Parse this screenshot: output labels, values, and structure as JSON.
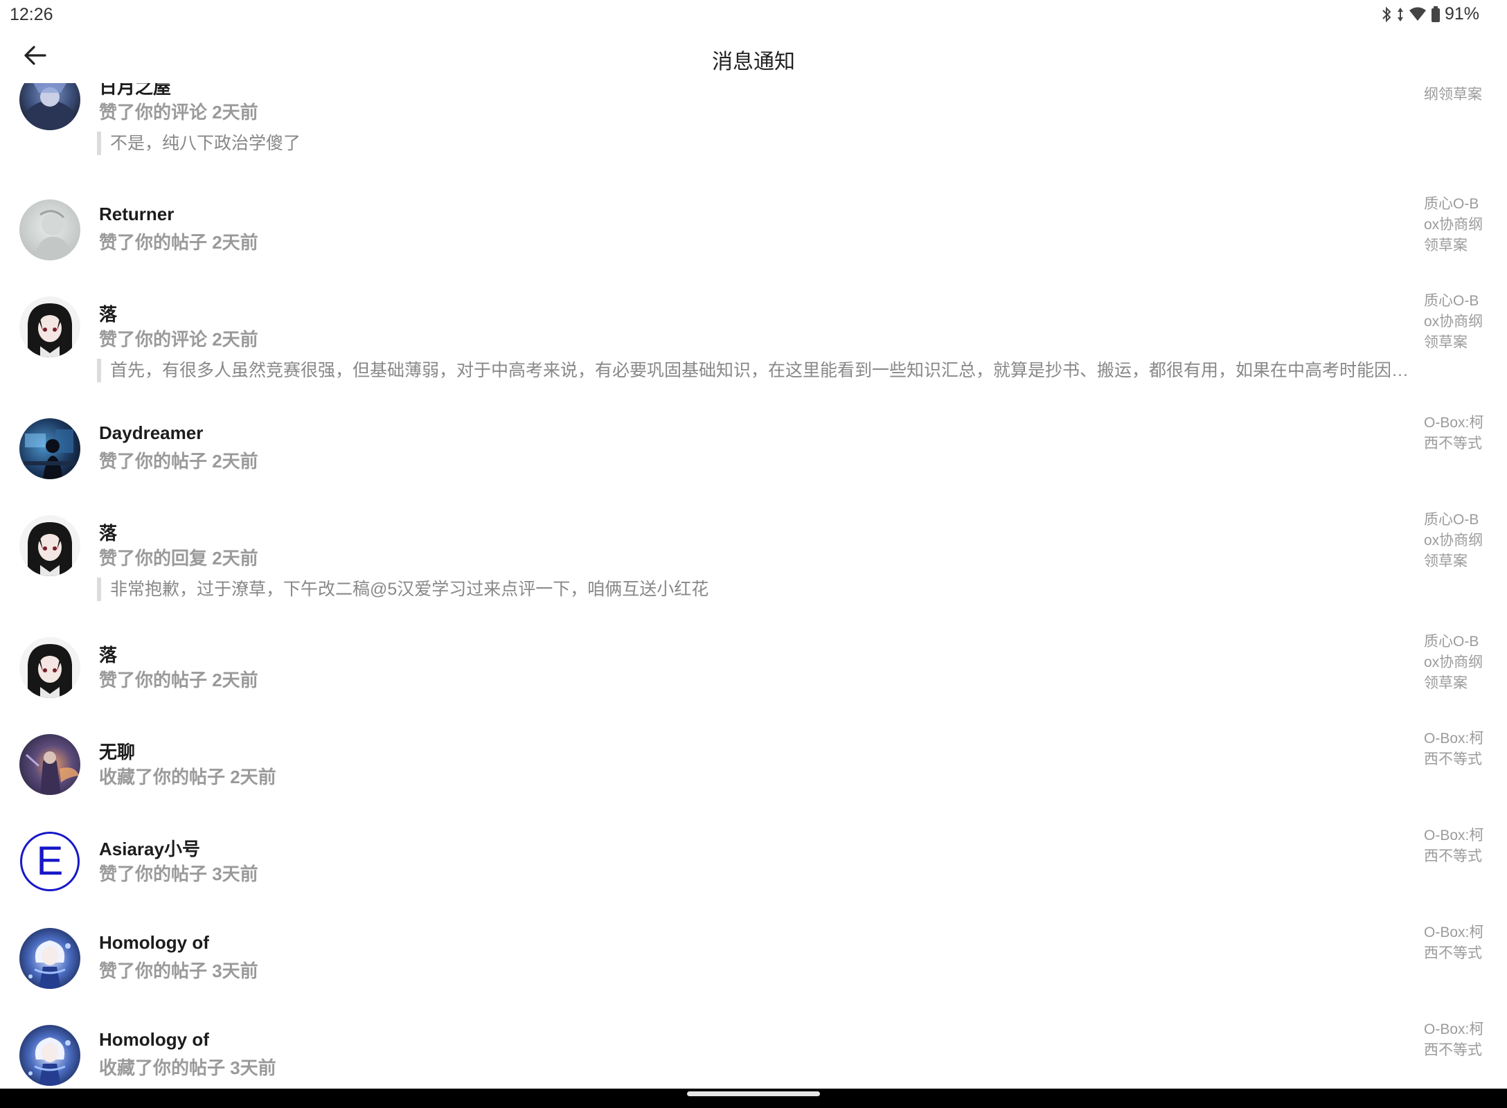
{
  "status": {
    "time": "12:26",
    "battery": "91%",
    "icons": [
      "bluetooth-icon",
      "data-arrows-icon",
      "wifi-icon",
      "battery-icon"
    ]
  },
  "header": {
    "title": "消息通知",
    "back_icon": "arrow-left-icon"
  },
  "items": [
    {
      "name": "日月之屋",
      "action": "赞了你的评论 2天前",
      "quote": "不是，纯八下政治学傻了",
      "source": "Box协商纲领草案",
      "avatar": "dark-armor"
    },
    {
      "name": "Returner",
      "action": "赞了你的帖子 2天前",
      "quote": "",
      "source": "质心O-Box协商纲领草案",
      "avatar": "pale-sketch"
    },
    {
      "name": "落",
      "action": "赞了你的评论 2天前",
      "quote": "首先，有很多人虽然竞赛很强，但基础薄弱，对于中高考来说，有必要巩固基础知识，在这里能看到一些知识汇总，就算是抄书、搬运，都很有用，如果在中高考时能因此多…",
      "source": "质心O-Box协商纲领草案",
      "avatar": "anime-black-hair"
    },
    {
      "name": "Daydreamer",
      "action": "赞了你的帖子 2天前",
      "quote": "",
      "source": "O-Box:柯西不等式",
      "avatar": "night-room"
    },
    {
      "name": "落",
      "action": "赞了你的回复 2天前",
      "quote": "非常抱歉，过于潦草，下午改二稿@5汉爱学习过来点评一下，咱俩互送小红花",
      "source": "质心O-Box协商纲领草案",
      "avatar": "anime-black-hair"
    },
    {
      "name": "落",
      "action": "赞了你的帖子 2天前",
      "quote": "",
      "source": "质心O-Box协商纲领草案",
      "avatar": "anime-black-hair"
    },
    {
      "name": "无聊",
      "action": "收藏了你的帖子 2天前",
      "quote": "",
      "source": "O-Box:柯西不等式",
      "avatar": "fantasy-warrior"
    },
    {
      "name": "Asiaray小号",
      "action": "赞了你的帖子 3天前",
      "quote": "",
      "source": "O-Box:柯西不等式",
      "avatar": "letter-e"
    },
    {
      "name": "Homology of",
      "action": "赞了你的帖子 3天前",
      "quote": "",
      "source": "O-Box:柯西不等式",
      "avatar": "anime-blue-dress"
    },
    {
      "name": "Homology of",
      "action": "收藏了你的帖子 3天前",
      "quote": "",
      "source": "O-Box:柯西不等式",
      "avatar": "anime-blue-dress"
    }
  ]
}
